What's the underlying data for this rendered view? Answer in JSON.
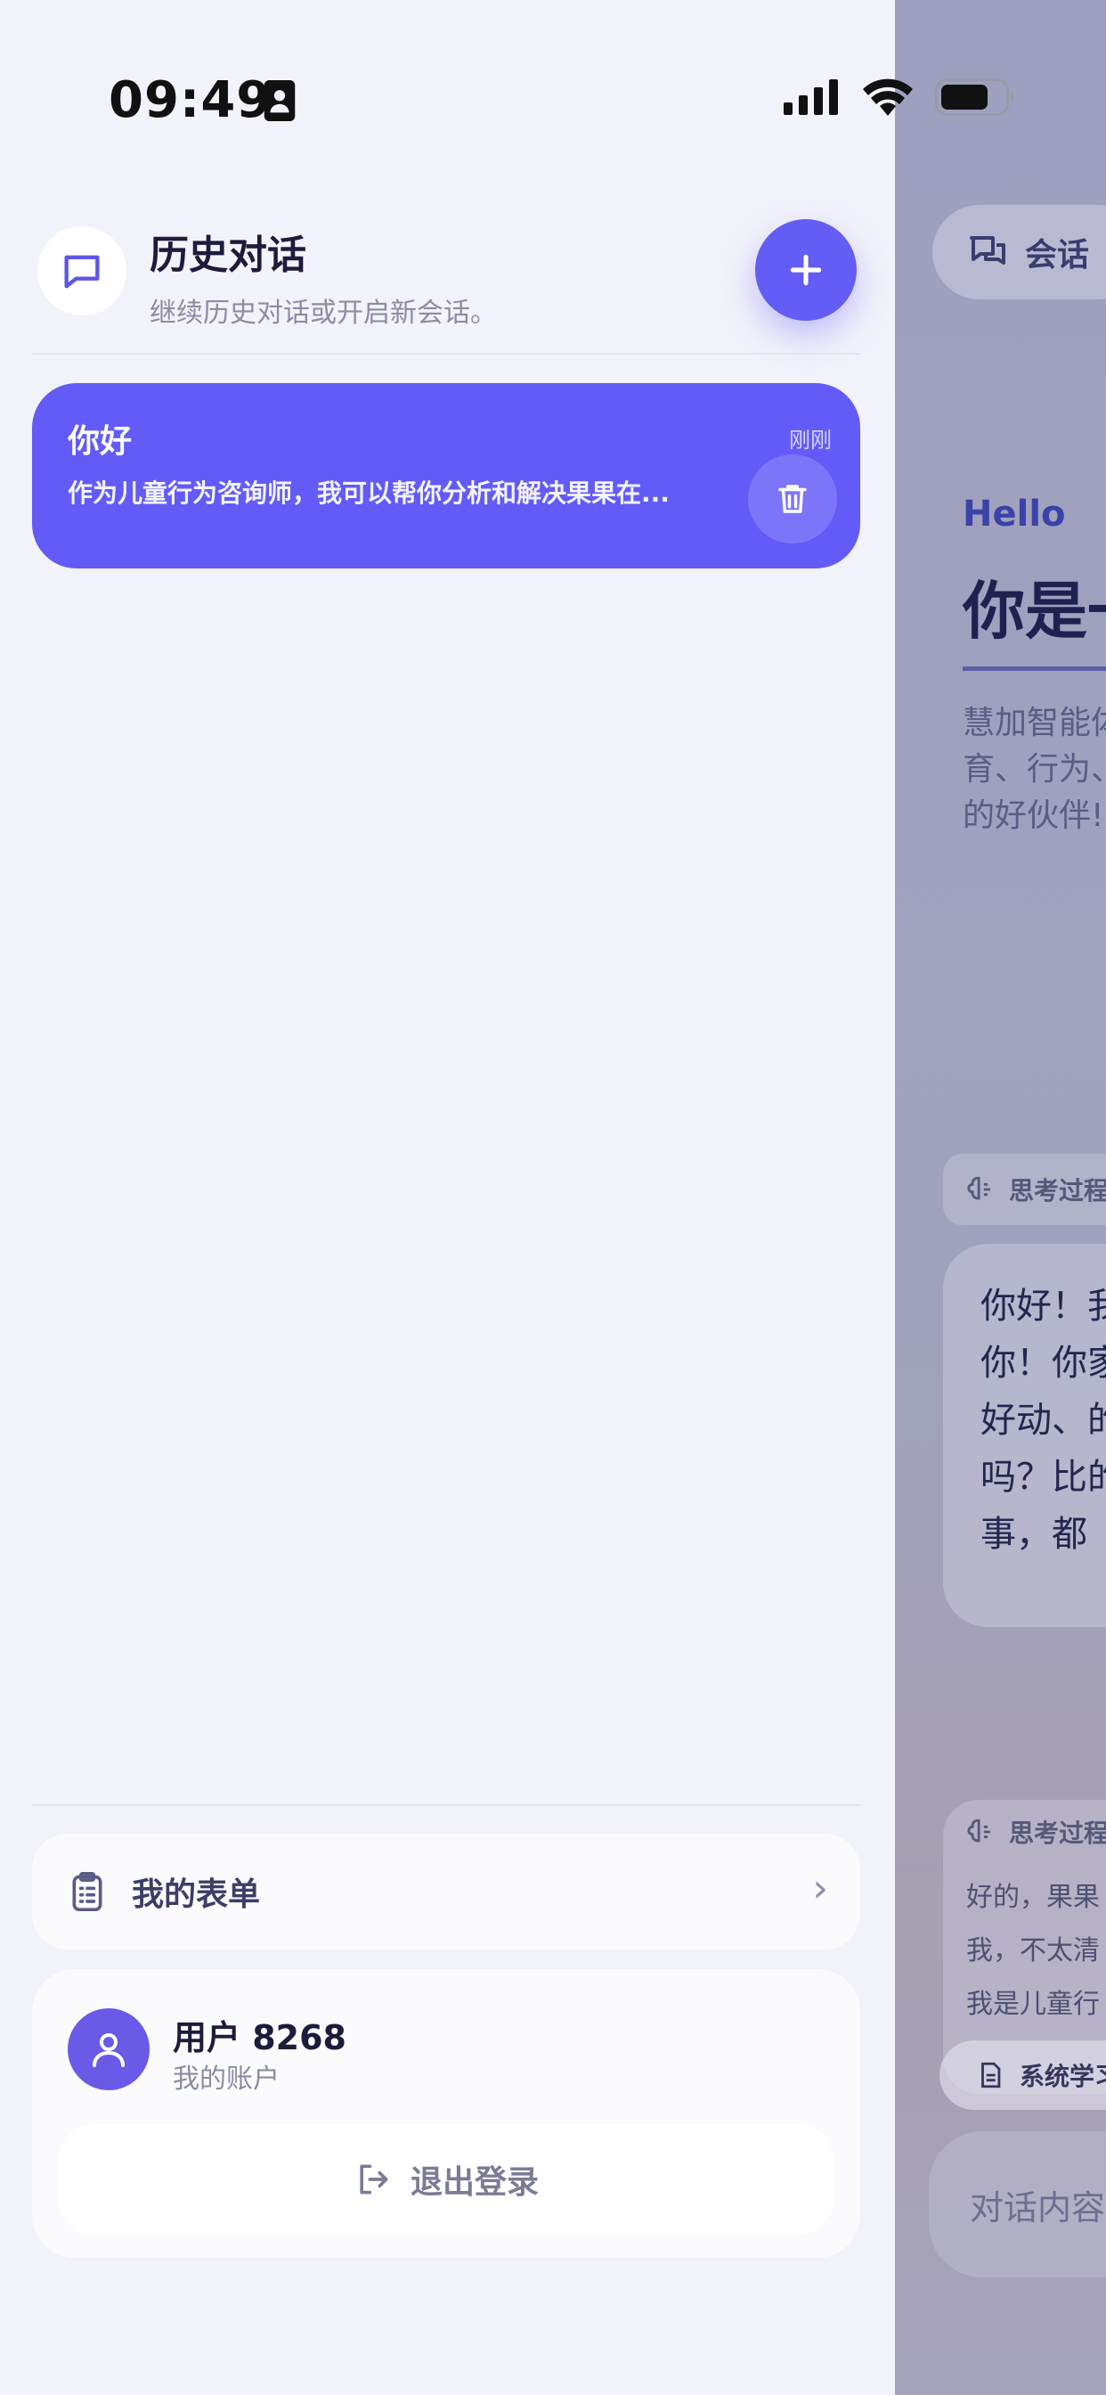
{
  "status_bar": {
    "time": "09:49"
  },
  "drawer": {
    "header": {
      "title": "历史对话",
      "subtitle": "继续历史对话或开启新会话。",
      "icon": "chat-bubble-icon",
      "new_button_icon": "plus-icon"
    },
    "conversations": [
      {
        "title": "你好",
        "time": "刚刚",
        "preview": "作为儿童行为咨询师，我可以帮你分析和解决果果在...",
        "delete_icon": "trash-icon"
      }
    ],
    "menu": {
      "my_forms_label": "我的表单",
      "chevron": "›"
    },
    "account": {
      "name": "用户 8268",
      "subtitle": "我的账户",
      "logout_label": "退出登录"
    }
  },
  "background_page": {
    "session_button": "会话",
    "hello": "Hello",
    "title": "你是一",
    "description": "慧加智能体育、行为、的好伙伴!",
    "think_label_1": "思考过程",
    "bubble_text": "你好！我你！你家泼好动、的吗？比的事，都",
    "think_label_2": "思考过程",
    "reply_lines": [
      "好的，果果",
      "我，不太清",
      "我是儿童行"
    ],
    "chip_label": "系统学习",
    "input_placeholder": "对话内容"
  },
  "colors": {
    "accent": "#635bf8",
    "background": "#f2f2fa",
    "title_text": "#1c1c3c",
    "muted_text": "#8a8ca3"
  }
}
